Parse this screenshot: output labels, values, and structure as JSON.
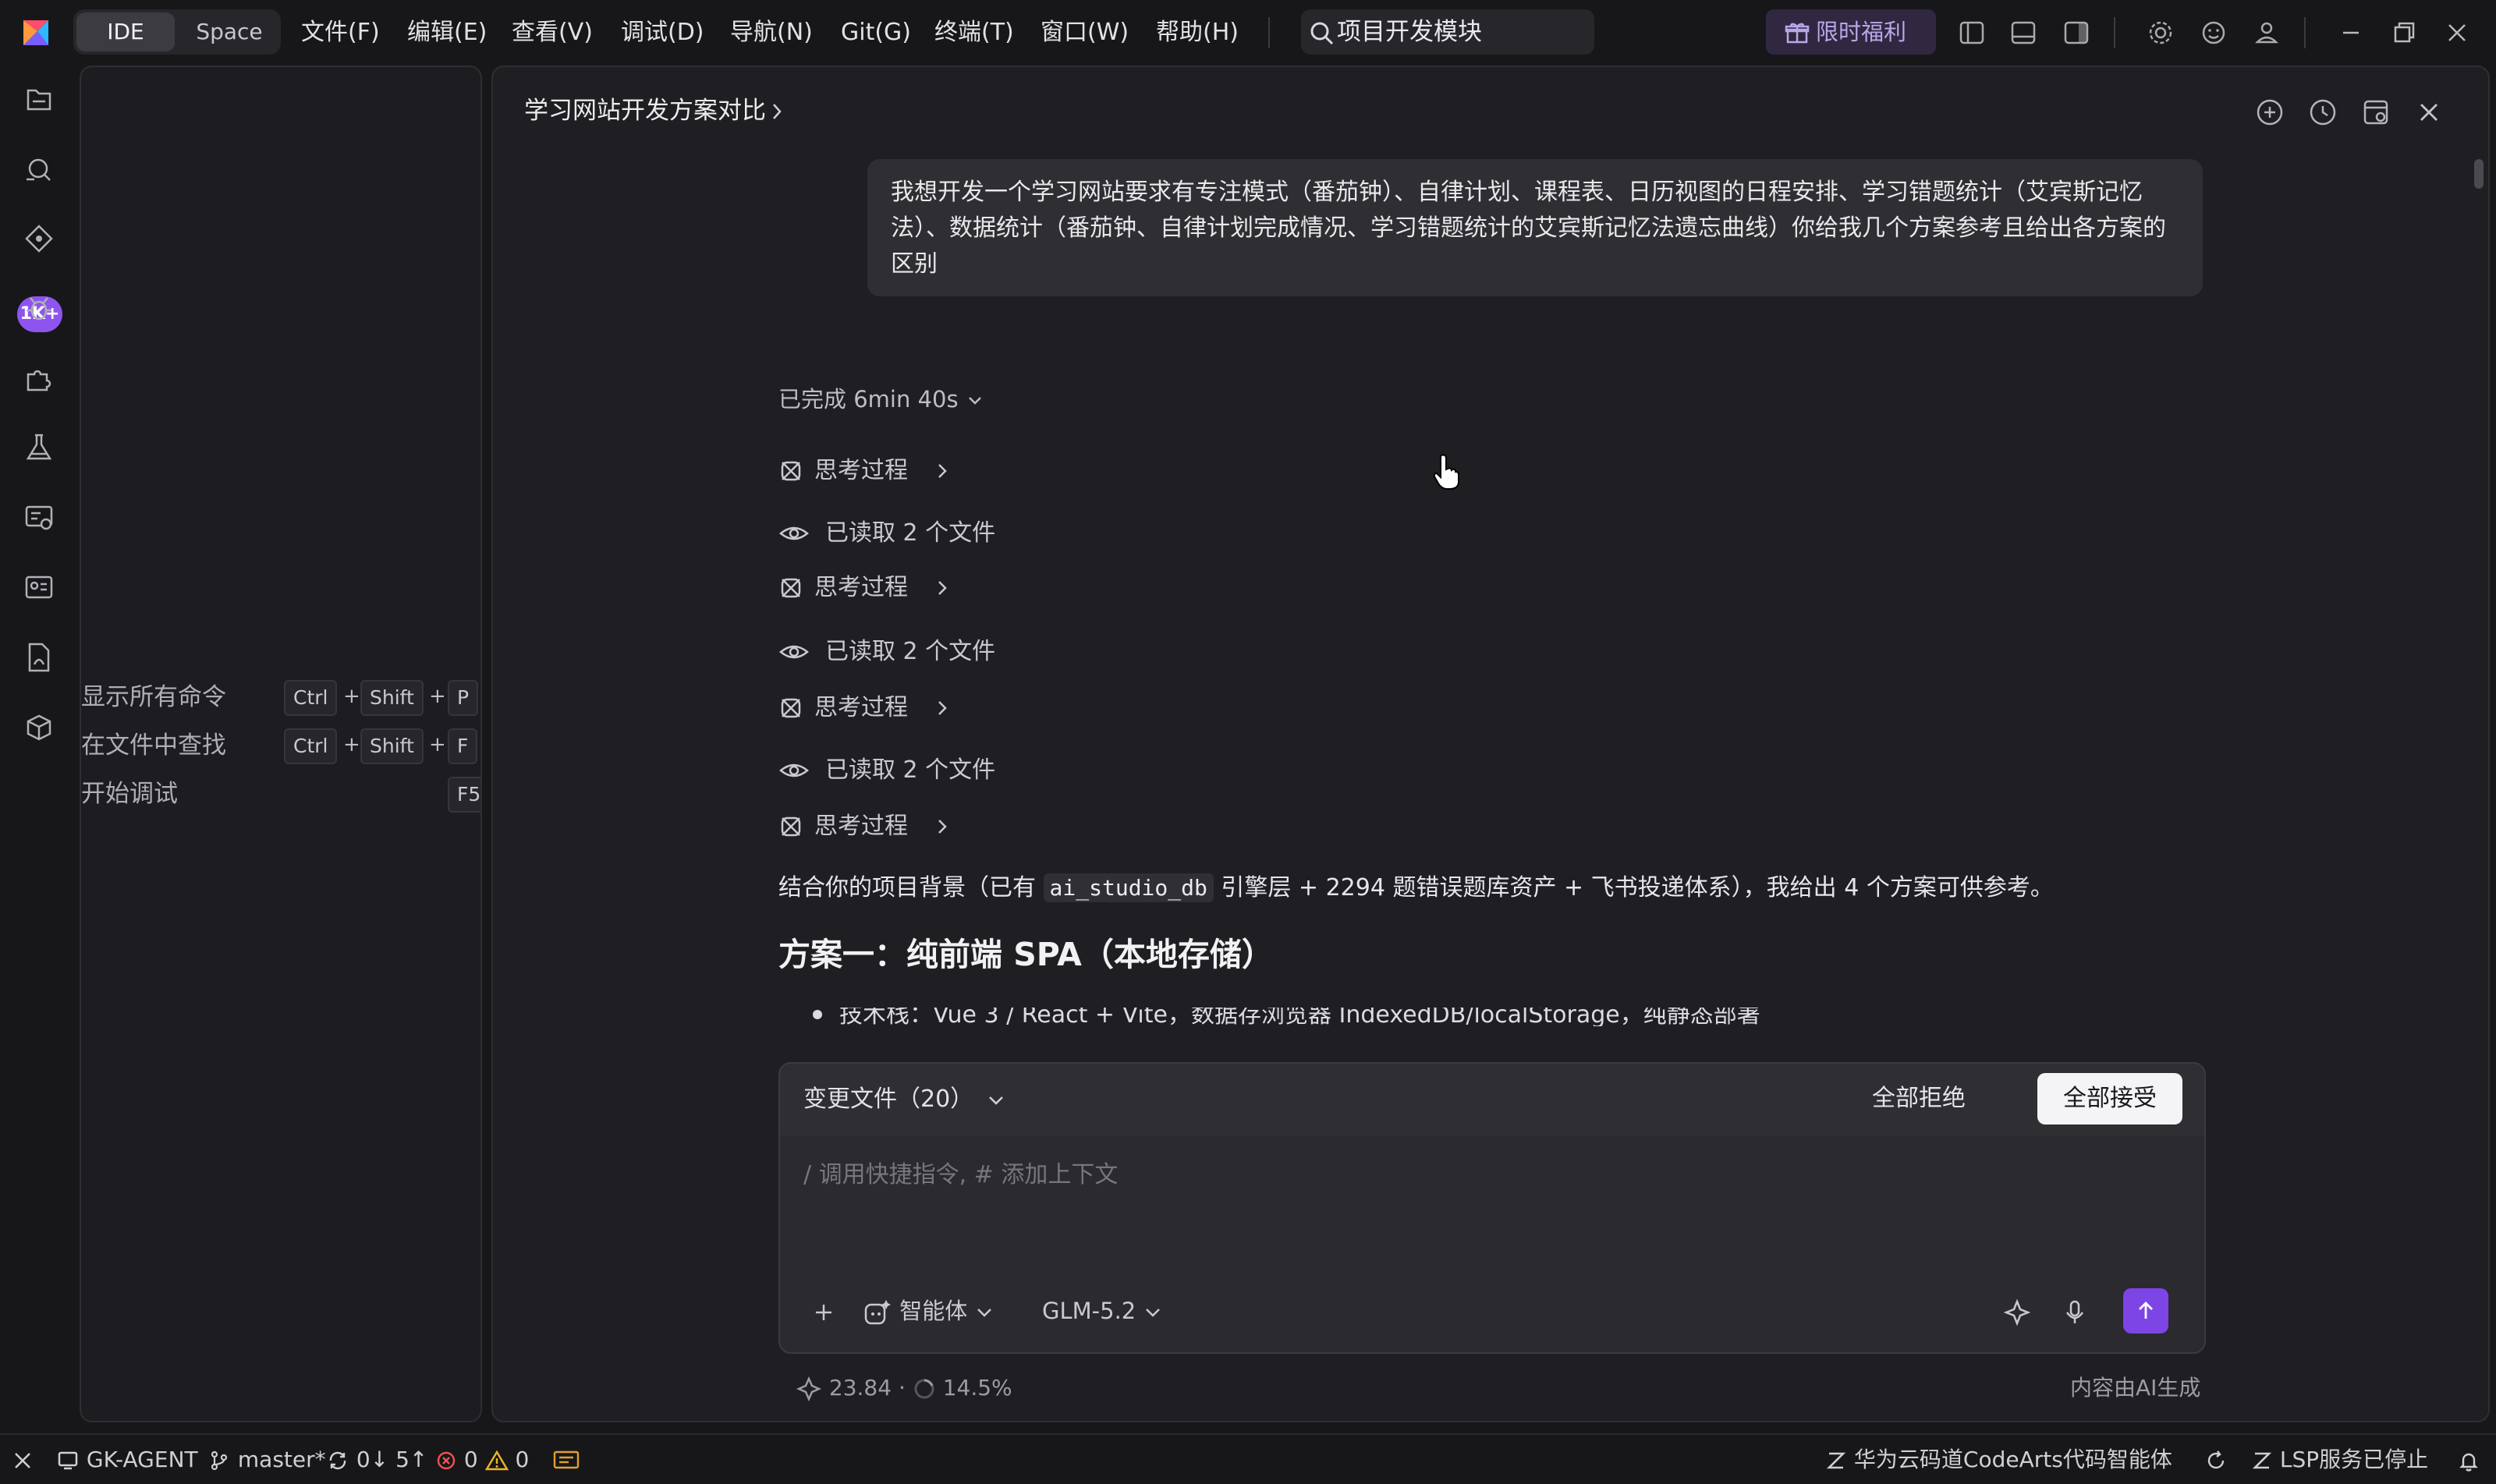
{
  "titlebar": {
    "mode_ide": "IDE",
    "mode_space": "Space",
    "menus": [
      "文件(F)",
      "编辑(E)",
      "查看(V)",
      "调试(D)",
      "导航(N)",
      "Git(G)",
      "终端(T)",
      "窗口(W)",
      "帮助(H)"
    ],
    "search_text": "项目开发模块",
    "promo_label": "限时福利"
  },
  "activity": {
    "badge": "1K+"
  },
  "commands": [
    {
      "label": "显示所有命令",
      "keys": [
        "Ctrl",
        "Shift",
        "P"
      ]
    },
    {
      "label": "在文件中查找",
      "keys": [
        "Ctrl",
        "Shift",
        "F"
      ]
    },
    {
      "label": "开始调试",
      "keys": [
        "F5"
      ]
    }
  ],
  "chat": {
    "breadcrumb": "学习网站开发方案对比",
    "user_message": "我想开发一个学习网站要求有专注模式（番茄钟）、自律计划、课程表、日历视图的日程安排、学习错题统计（艾宾斯记忆法）、数据统计（番茄钟、自律计划完成情况、学习错题统计的艾宾斯记忆法遗忘曲线）你给我几个方案参考且给出各方案的区别",
    "status": "已完成 6min 40s",
    "steps": [
      "思考过程",
      "已读取 2 个文件",
      "思考过程",
      "已读取 2 个文件",
      "思考过程",
      "已读取 2 个文件",
      "思考过程"
    ],
    "intro_before": "结合你的项目背景（已有 ",
    "intro_code": "ai_studio_db",
    "intro_after": " 引擎层 + 2294 题错误题库资产 + 飞书投递体系），我给出 4 个方案可供参考。",
    "heading": "方案一：纯前端 SPA（本地存储）",
    "bullet": "技术栈：Vue 3 / React + Vite，数据存浏览器 IndexedDB/localStorage，纯静态部署"
  },
  "input": {
    "changes_label": "变更文件（20）",
    "reject_label": "全部拒绝",
    "accept_label": "全部接受",
    "placeholder": "/ 调用快捷指令, # 添加上下文",
    "agent_label": "智能体",
    "model_label": "GLM-5.2"
  },
  "footer": {
    "tokens": "23.84",
    "percent": "14.5%",
    "ai_note": "内容由AI生成"
  },
  "statusbar": {
    "project": "GK-AGENT",
    "branch": "master*",
    "sync": "0↓ 5↑",
    "errors": "0",
    "warnings": "0",
    "codearts": "华为云码道CodeArts代码智能体",
    "lsp": "LSP服务已停止"
  }
}
